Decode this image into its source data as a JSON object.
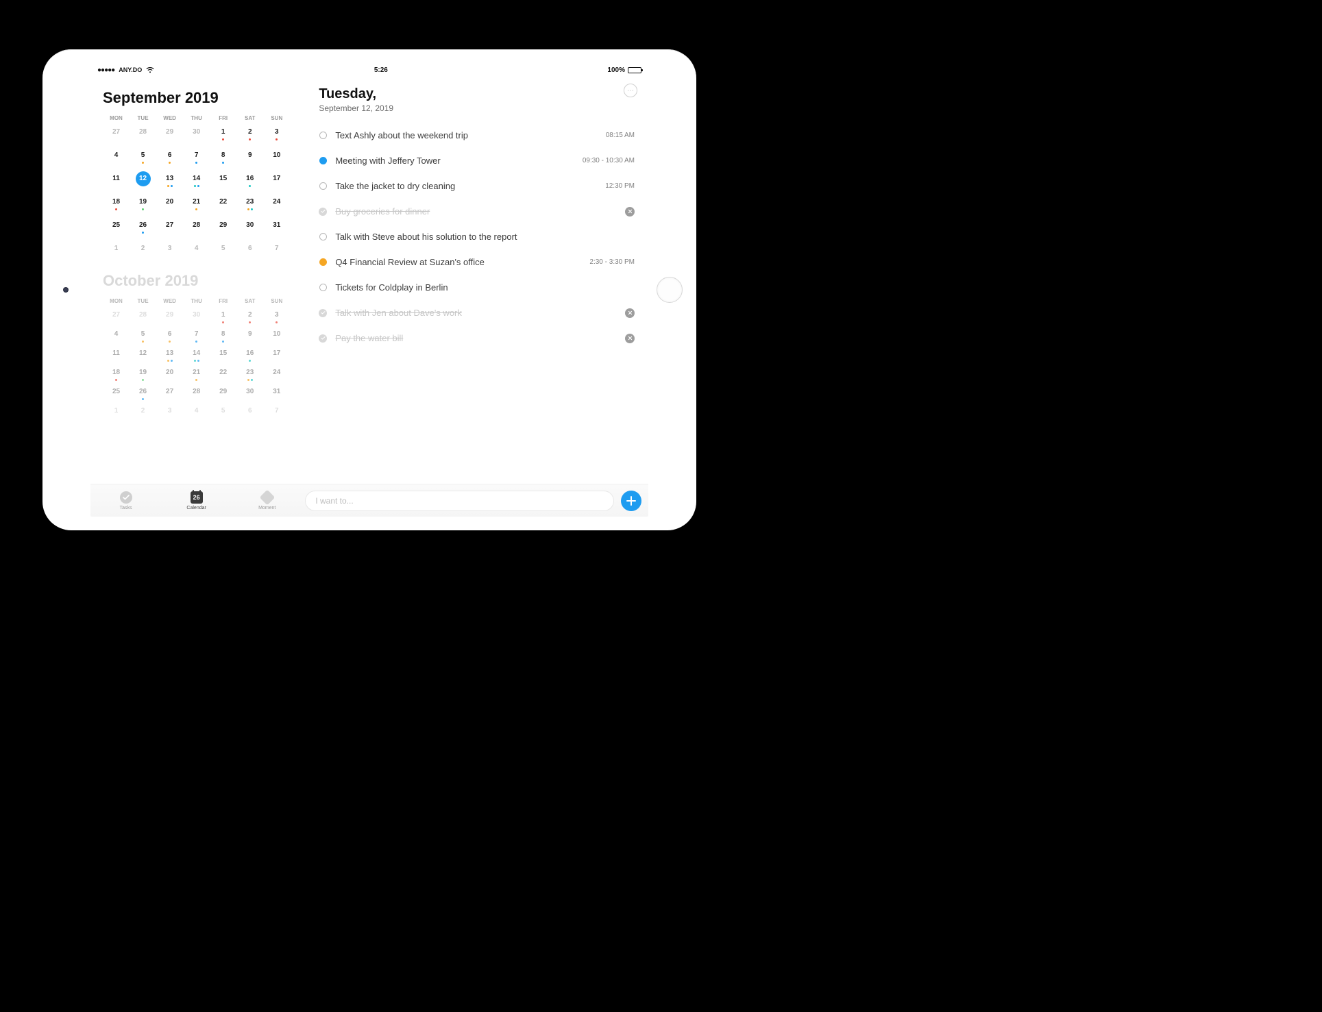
{
  "status": {
    "carrier_dots": "●●●●●",
    "carrier": "ANY.DO",
    "time": "5:26",
    "battery_text": "100%"
  },
  "calendar": {
    "month1": {
      "title": "September 2019",
      "weekdays": [
        "MON",
        "TUE",
        "WED",
        "THU",
        "FRI",
        "SAT",
        "SUN"
      ],
      "selected_day": 12,
      "days": [
        {
          "n": "27",
          "out": true
        },
        {
          "n": "28",
          "out": true
        },
        {
          "n": "29",
          "out": true
        },
        {
          "n": "30",
          "out": true
        },
        {
          "n": "1",
          "dots": [
            "red"
          ]
        },
        {
          "n": "2",
          "dots": [
            "red"
          ]
        },
        {
          "n": "3",
          "dots": [
            "red"
          ]
        },
        {
          "n": "4"
        },
        {
          "n": "5",
          "dots": [
            "orange"
          ]
        },
        {
          "n": "6",
          "dots": [
            "orange"
          ]
        },
        {
          "n": "7",
          "dots": [
            "blue"
          ]
        },
        {
          "n": "8",
          "dots": [
            "blue"
          ]
        },
        {
          "n": "9"
        },
        {
          "n": "10"
        },
        {
          "n": "11"
        },
        {
          "n": "12",
          "selected": true
        },
        {
          "n": "13",
          "dots": [
            "orange",
            "blue"
          ]
        },
        {
          "n": "14",
          "dots": [
            "teal",
            "blue"
          ]
        },
        {
          "n": "15"
        },
        {
          "n": "16",
          "dots": [
            "teal"
          ]
        },
        {
          "n": "17"
        },
        {
          "n": "18",
          "dots": [
            "red"
          ]
        },
        {
          "n": "19",
          "dots": [
            "green"
          ]
        },
        {
          "n": "20"
        },
        {
          "n": "21",
          "dots": [
            "orange"
          ]
        },
        {
          "n": "22"
        },
        {
          "n": "23",
          "dots": [
            "orange",
            "teal"
          ]
        },
        {
          "n": "24"
        },
        {
          "n": "25"
        },
        {
          "n": "26",
          "dots": [
            "blue"
          ]
        },
        {
          "n": "27"
        },
        {
          "n": "28"
        },
        {
          "n": "29"
        },
        {
          "n": "30"
        },
        {
          "n": "31"
        },
        {
          "n": "1",
          "out": true
        },
        {
          "n": "2",
          "out": true
        },
        {
          "n": "3",
          "out": true
        },
        {
          "n": "4",
          "out": true
        },
        {
          "n": "5",
          "out": true
        },
        {
          "n": "6",
          "out": true
        },
        {
          "n": "7",
          "out": true
        }
      ]
    },
    "month2": {
      "title": "October 2019",
      "weekdays": [
        "MON",
        "TUE",
        "WED",
        "THU",
        "FRI",
        "SAT",
        "SUN"
      ],
      "days": [
        {
          "n": "27",
          "out": true
        },
        {
          "n": "28",
          "out": true
        },
        {
          "n": "29",
          "out": true
        },
        {
          "n": "30",
          "out": true
        },
        {
          "n": "1",
          "dots": [
            "red"
          ]
        },
        {
          "n": "2",
          "dots": [
            "red"
          ]
        },
        {
          "n": "3",
          "dots": [
            "red"
          ]
        },
        {
          "n": "4"
        },
        {
          "n": "5",
          "dots": [
            "orange"
          ]
        },
        {
          "n": "6",
          "dots": [
            "orange"
          ]
        },
        {
          "n": "7",
          "dots": [
            "blue"
          ]
        },
        {
          "n": "8",
          "dots": [
            "blue"
          ]
        },
        {
          "n": "9"
        },
        {
          "n": "10"
        },
        {
          "n": "11"
        },
        {
          "n": "12"
        },
        {
          "n": "13",
          "dots": [
            "orange",
            "blue"
          ]
        },
        {
          "n": "14",
          "dots": [
            "teal",
            "blue"
          ]
        },
        {
          "n": "15"
        },
        {
          "n": "16",
          "dots": [
            "teal"
          ]
        },
        {
          "n": "17"
        },
        {
          "n": "18",
          "dots": [
            "red"
          ]
        },
        {
          "n": "19",
          "dots": [
            "green"
          ]
        },
        {
          "n": "20"
        },
        {
          "n": "21",
          "dots": [
            "orange"
          ]
        },
        {
          "n": "22"
        },
        {
          "n": "23",
          "dots": [
            "orange",
            "teal"
          ]
        },
        {
          "n": "24"
        },
        {
          "n": "25"
        },
        {
          "n": "26",
          "dots": [
            "blue"
          ]
        },
        {
          "n": "27"
        },
        {
          "n": "28"
        },
        {
          "n": "29"
        },
        {
          "n": "30"
        },
        {
          "n": "31"
        },
        {
          "n": "1",
          "out": true
        },
        {
          "n": "2",
          "out": true
        },
        {
          "n": "3",
          "out": true
        },
        {
          "n": "4",
          "out": true
        },
        {
          "n": "5",
          "out": true
        },
        {
          "n": "6",
          "out": true
        },
        {
          "n": "7",
          "out": true
        }
      ]
    }
  },
  "tabs": {
    "tasks": "Tasks",
    "calendar": "Calendar",
    "calendar_day": "26",
    "moment": "Moment"
  },
  "day_header": {
    "weekday": "Tuesday,",
    "date": "September 12, 2019"
  },
  "agenda": [
    {
      "bullet": "ring",
      "title": "Text Ashly about the weekend trip",
      "time": "08:15 AM",
      "completed": false
    },
    {
      "bullet": "solid-blue",
      "title": "Meeting with Jeffery Tower",
      "time": "09:30 - 10:30 AM",
      "completed": false
    },
    {
      "bullet": "ring",
      "title": "Take the jacket to dry cleaning",
      "time": "12:30 PM",
      "completed": false
    },
    {
      "bullet": "done",
      "title": "Buy groceries for dinner",
      "time": "",
      "completed": true
    },
    {
      "bullet": "ring",
      "title": "Talk with Steve about his solution to the report",
      "time": "",
      "completed": false
    },
    {
      "bullet": "solid-orange",
      "title": "Q4 Financial Review at Suzan's office",
      "time": "2:30 - 3:30 PM",
      "completed": false
    },
    {
      "bullet": "ring",
      "title": "Tickets for Coldplay in Berlin",
      "time": "",
      "completed": false
    },
    {
      "bullet": "done",
      "title": "Talk with Jen about Dave's work",
      "time": "",
      "completed": true
    },
    {
      "bullet": "done",
      "title": "Pay the water bill",
      "time": "",
      "completed": true
    }
  ],
  "input": {
    "placeholder": "I want to..."
  }
}
